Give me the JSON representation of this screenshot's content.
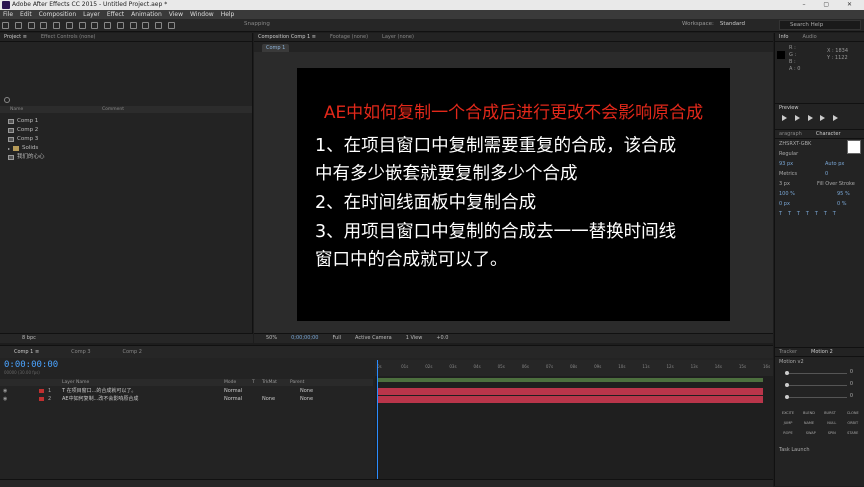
{
  "app": {
    "title": "Adobe After Effects CC 2015 - Untitled Project.aep *",
    "menu": [
      "File",
      "Edit",
      "Composition",
      "Layer",
      "Effect",
      "Animation",
      "View",
      "Window",
      "Help"
    ],
    "snapping": "Snapping",
    "workspace_label": "Workspace:",
    "workspace_value": "Standard",
    "search_placeholder": "Search Help"
  },
  "project_panel": {
    "tabs": [
      "Project ≡",
      "Effect Controls (none)"
    ],
    "columns": [
      "Name",
      "Comment"
    ],
    "items": [
      {
        "name": "Comp 1",
        "type": "comp"
      },
      {
        "name": "Comp 2",
        "type": "comp"
      },
      {
        "name": "Comp 3",
        "type": "comp"
      },
      {
        "name": "Solids",
        "type": "folder"
      },
      {
        "name": "我们的心心",
        "type": "comp"
      }
    ],
    "bpc": "8 bpc"
  },
  "composition_panel": {
    "tabs": [
      "Composition Comp 1 ≡",
      "Footage (none)",
      "Layer (none)"
    ],
    "active_comp_tab": "Comp 1",
    "slide": {
      "title": "AE中如何复制一个合成后进行更改不会影响原合成",
      "lines": [
        "1、在项目窗口中复制需要重复的合成，该合成",
        "中有多少嵌套就要复制多少个合成",
        "2、在时间线面板中复制合成",
        "3、用项目窗口中复制的合成去一一替换时间线",
        "窗口中的合成就可以了。"
      ]
    },
    "footer": {
      "zoom": "50%",
      "timecode": "0;00;00;00",
      "resolution": "Full",
      "camera": "Active Camera",
      "view": "1 View",
      "offset": "+0.0"
    }
  },
  "info_panel": {
    "tabs": [
      "Info",
      "Audio"
    ],
    "r": "R :",
    "g": "G :",
    "b": "B :",
    "a": "A : 0",
    "x": "X : 1834",
    "y": "Y : 1122"
  },
  "preview_panel": {
    "label": "Preview"
  },
  "character_panel": {
    "tabs": [
      "aragraph",
      "Character"
    ],
    "font": "ZHSRXT-GBK",
    "style": "Regular",
    "size": "93 px",
    "leading": "Auto px",
    "kerning": "Metrics",
    "tracking": "0",
    "stroke_width": "3 px",
    "stroke_type": "Fill Over Stroke",
    "vscale": "100 %",
    "hscale": "95 %",
    "baseline": "0 px",
    "tsume": "0 %"
  },
  "motion_panel": {
    "tabs": [
      "Tracker",
      "Motion 2"
    ],
    "preset": "Motion v2",
    "sliders": [
      {
        "value": "0"
      },
      {
        "value": "0"
      },
      {
        "value": "0"
      }
    ],
    "buttons": [
      "EXCITE",
      "BLEND",
      "BURST",
      "CLONE",
      "JUMP",
      "NAME",
      "NULL",
      "ORBIT",
      "ROPE",
      "SWAP",
      "SPIN",
      "STARE"
    ],
    "task_launch": "Task Launch"
  },
  "timeline": {
    "tabs": [
      "Comp 1 ≡",
      "Comp 3",
      "Comp 2"
    ],
    "timecode": "0:00:00:00",
    "fps": "00000 (30.00 fps)",
    "columns": [
      "Layer Name",
      "Mode",
      "T",
      "TrkMat",
      "Parent"
    ],
    "layers": [
      {
        "num": "1",
        "name": "T 在项目窗口...的合成就可以了。",
        "mode": "Normal",
        "trkmat": "",
        "parent": "None"
      },
      {
        "num": "2",
        "name": "AE中如何复制...改不会影响原合成",
        "mode": "Normal",
        "trkmat": "None",
        "parent": "None"
      }
    ],
    "ruler_labels": [
      "0s",
      "01s",
      "02s",
      "03s",
      "04s",
      "05s",
      "06s",
      "07s",
      "08s",
      "09s",
      "10s",
      "11s",
      "12s",
      "13s",
      "14s",
      "15s",
      "16s"
    ]
  },
  "colors": {
    "accent_blue": "#2a8cff",
    "slide_title_red": "#e2281a",
    "track_red": "#b9354a",
    "workarea_green": "#4c6f3e"
  }
}
